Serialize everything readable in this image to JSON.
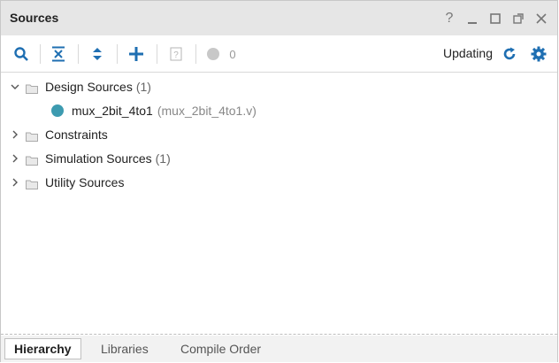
{
  "panel": {
    "title": "Sources",
    "window_controls": [
      {
        "name": "help-icon",
        "glyph": "?"
      },
      {
        "name": "minimize-icon",
        "glyph": "_"
      },
      {
        "name": "maximize-icon",
        "glyph": "□"
      },
      {
        "name": "float-icon",
        "glyph": "⧉"
      },
      {
        "name": "close-icon",
        "glyph": "✕"
      }
    ]
  },
  "toolbar": {
    "search_icon": "search-icon",
    "collapse_all_icon": "collapse-all-icon",
    "expand_all_icon": "expand-all-icon",
    "add_icon": "add-icon",
    "help_box_icon": "unknown-file-icon",
    "count_badge": "0",
    "status_text": "Updating",
    "refresh_icon": "refresh-icon",
    "settings_icon": "gear-icon"
  },
  "tree": {
    "items": [
      {
        "label": "Design Sources",
        "count": "(1)",
        "expanded": true
      },
      {
        "label": "mux_2bit_4to1",
        "file": "(mux_2bit_4to1.v)"
      },
      {
        "label": "Constraints",
        "count": "",
        "expanded": false
      },
      {
        "label": "Simulation Sources",
        "count": "(1)",
        "expanded": false
      },
      {
        "label": "Utility Sources",
        "count": "",
        "expanded": false
      }
    ]
  },
  "tabs": [
    {
      "label": "Hierarchy",
      "active": true
    },
    {
      "label": "Libraries",
      "active": false
    },
    {
      "label": "Compile Order",
      "active": false
    }
  ],
  "colors": {
    "accent": "#1f6fb2",
    "module_dot": "#3d9bb0"
  }
}
